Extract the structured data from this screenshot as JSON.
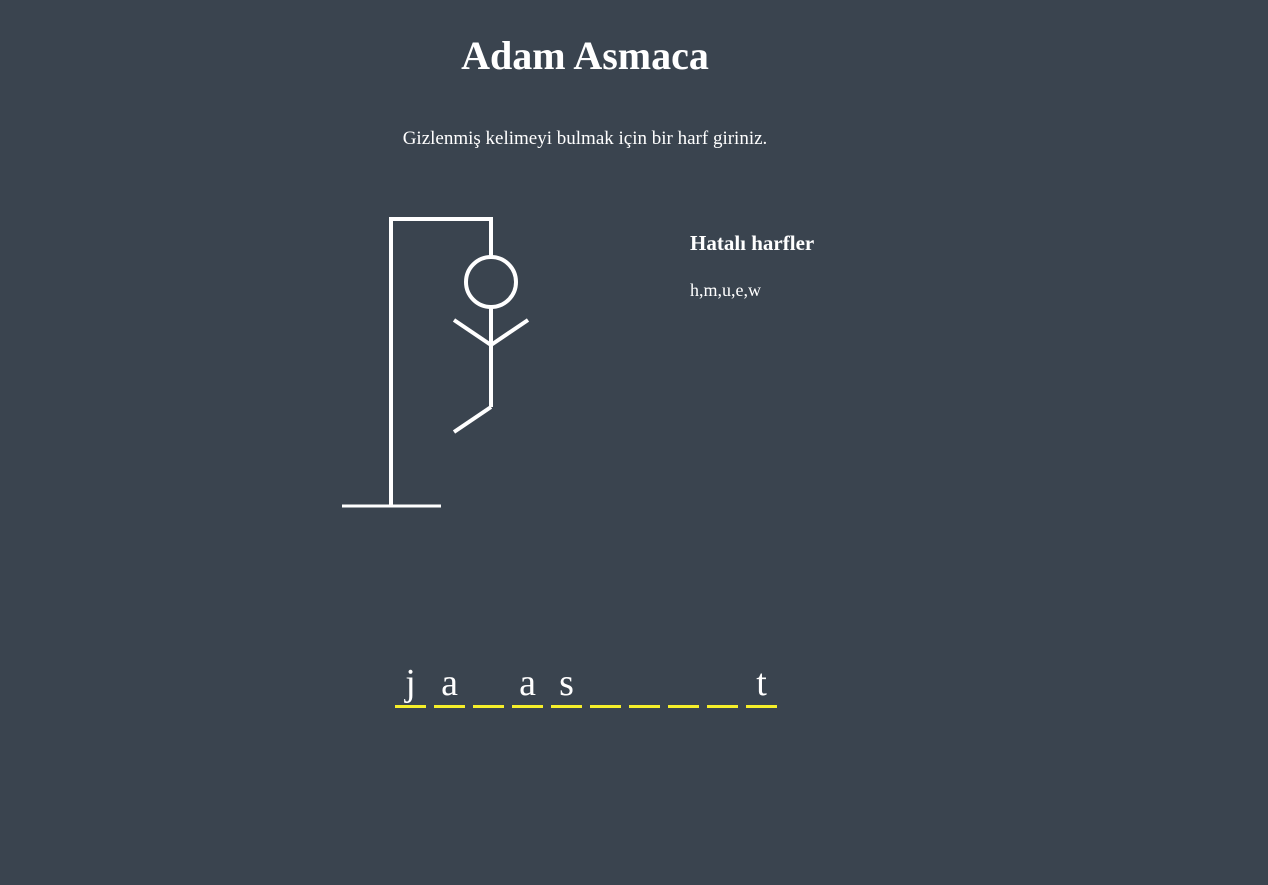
{
  "title": "Adam Asmaca",
  "instruction": "Gizlenmiş kelimeyi bulmak için bir harf giriniz.",
  "wrong_letters": {
    "heading": "Hatalı harfler",
    "letters": "h,m,u,e,w"
  },
  "hangman": {
    "parts_shown": [
      "head",
      "body",
      "left-arm",
      "right-arm",
      "left-leg"
    ]
  },
  "word": {
    "slots": [
      "j",
      "a",
      "",
      "a",
      "s",
      "",
      "",
      "",
      "",
      "t"
    ]
  },
  "colors": {
    "background": "#3a444f",
    "text": "#ffffff",
    "slot_underline": "#f5ef2a"
  }
}
